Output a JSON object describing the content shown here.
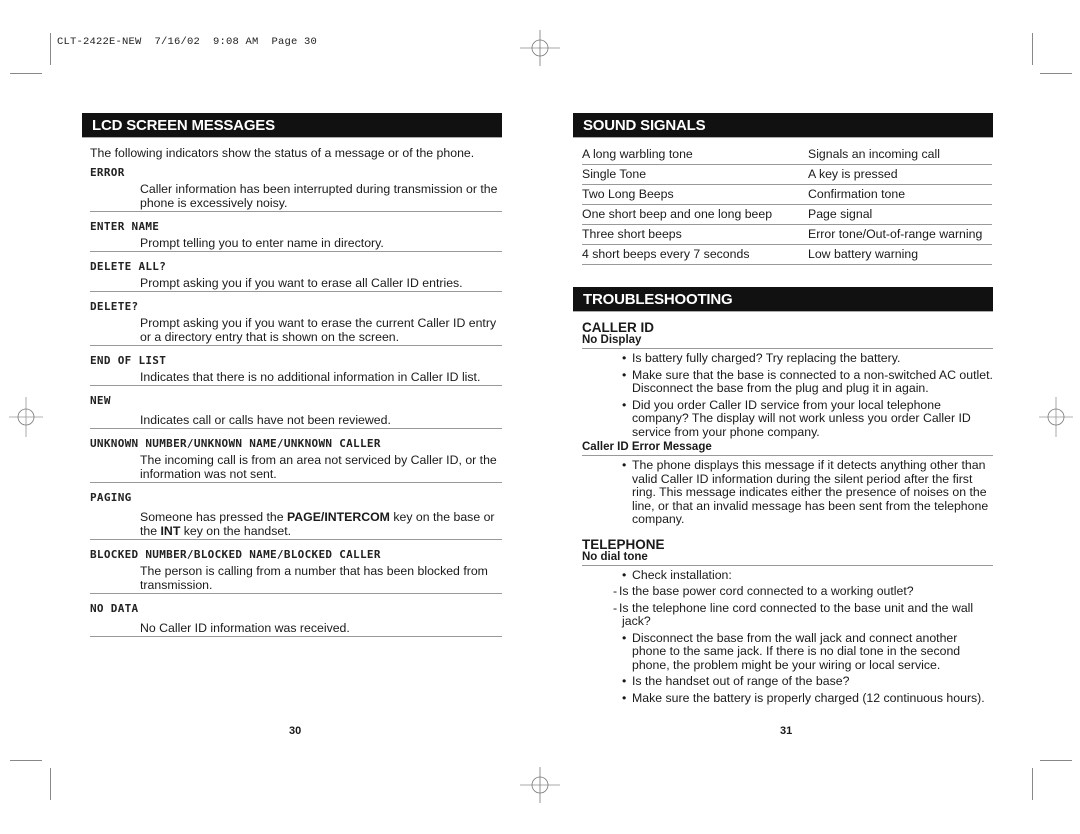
{
  "slug": "CLT-2422E-NEW  7/16/02  9:08 AM  Page 30",
  "left_page": {
    "banner": "LCD SCREEN MESSAGES",
    "intro": "The following indicators show the status of a message or of the phone.",
    "items": [
      {
        "code": "ERROR",
        "desc": "Caller information has been interrupted during transmission or the phone is excessively noisy."
      },
      {
        "code": "ENTER NAME",
        "desc": "Prompt telling you to enter name in directory."
      },
      {
        "code": "DELETE ALL?",
        "desc": "Prompt asking you if you want to erase all Caller ID entries."
      },
      {
        "code": "DELETE?",
        "desc": "Prompt asking you if you want to erase the current Caller ID entry or a directory entry that is shown on the screen."
      },
      {
        "code": "END OF LIST",
        "desc": "Indicates that there is no additional information in Caller ID list."
      },
      {
        "code": "NEW",
        "desc": "Indicates call or calls have not been reviewed."
      },
      {
        "code": "UNKNOWN NUMBER/UNKNOWN NAME/UNKNOWN CALLER",
        "desc": "The incoming call is from an area not serviced by Caller ID, or the information was not sent."
      },
      {
        "code": "PAGING",
        "desc_pre": "Someone has pressed the ",
        "desc_b1": "PAGE/INTERCOM",
        "desc_mid": " key on the base or the ",
        "desc_b2": "INT",
        "desc_post": " key on the handset."
      },
      {
        "code": "BLOCKED NUMBER/BLOCKED NAME/BLOCKED CALLER",
        "desc": "The person is calling from a number that has been blocked from transmission."
      },
      {
        "code": "NO DATA",
        "desc": "No Caller ID information was received."
      }
    ],
    "page_number": "30"
  },
  "right_page": {
    "sound_banner": "SOUND SIGNALS",
    "signals": [
      {
        "signal": "A long warbling tone",
        "meaning": "Signals an incoming call"
      },
      {
        "signal": "Single Tone",
        "meaning": "A key is pressed"
      },
      {
        "signal": "Two Long Beeps",
        "meaning": "Confirmation tone"
      },
      {
        "signal": "One short beep and one long beep",
        "meaning": "Page signal"
      },
      {
        "signal": "Three short beeps",
        "meaning": "Error tone/Out-of-range warning"
      },
      {
        "signal": "4 short beeps every 7 seconds",
        "meaning": "Low battery warning"
      }
    ],
    "ts_banner": "TROUBLESHOOTING",
    "caller_id": {
      "title": "CALLER ID",
      "no_display": {
        "title": "No Display",
        "bullets": [
          "Is battery fully charged? Try replacing the battery.",
          "Make sure that the base is connected to a non-switched AC outlet. Disconnect the base from the plug and plug it in again.",
          "Did you order Caller ID service from your local telephone company? The display will not work unless you order Caller ID service from your phone company."
        ]
      },
      "error_message": {
        "title": "Caller ID Error Message",
        "bullets": [
          "The phone displays this message if it detects anything other than valid Caller ID information during the silent period after the first ring. This message indicates either the presence of noises on the line, or that an invalid message has been sent from the telephone company."
        ]
      }
    },
    "telephone": {
      "title": "TELEPHONE",
      "no_dial_tone": {
        "title": "No dial tone",
        "items": [
          {
            "type": "bullet",
            "text": "Check installation:"
          },
          {
            "type": "dash",
            "text": "Is the base power cord connected to a working outlet?"
          },
          {
            "type": "dash",
            "text": "Is the telephone line cord connected to the base unit and the wall jack?"
          },
          {
            "type": "bullet",
            "text": "Disconnect the base from the wall jack and connect another phone to the same jack. If there is no dial tone in the second phone, the problem might be your wiring or local service."
          },
          {
            "type": "bullet",
            "text": "Is the handset out of range of the base?"
          },
          {
            "type": "bullet",
            "text": "Make sure the battery is properly charged (12 continuous hours)."
          }
        ]
      }
    },
    "page_number": "31"
  },
  "glyphs": {
    "bullet": "•",
    "dash": "-"
  }
}
